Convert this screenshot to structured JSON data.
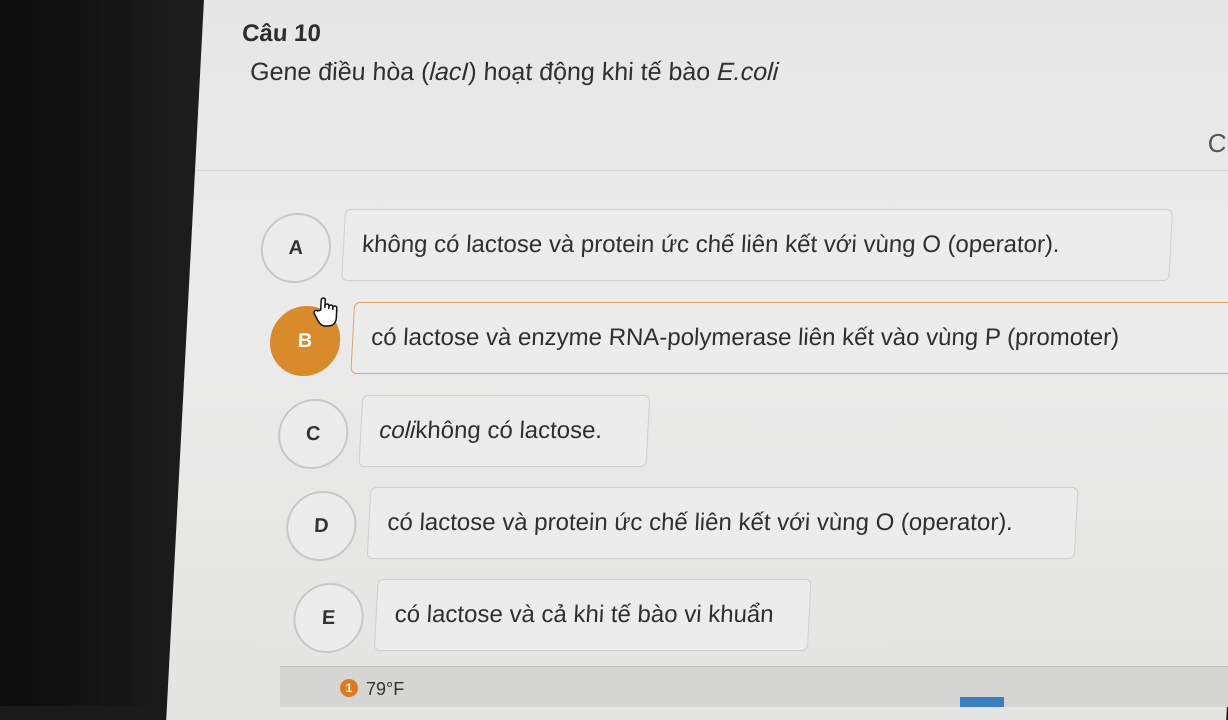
{
  "question": {
    "number": "Câu 10",
    "text_before": "Gene điều hòa (",
    "text_gene": "lacI",
    "text_middle": ") hoạt động khi tế bào ",
    "text_species": "E.coli"
  },
  "corner_icon": "C",
  "options": [
    {
      "letter": "A",
      "text": "không có lactose và protein ức chế liên kết với vùng O (operator)."
    },
    {
      "letter": "B",
      "text": "có lactose và enzyme RNA-polymerase liên kết vào vùng P (promoter)",
      "selected": true
    },
    {
      "letter": "C",
      "text_ital": "coli",
      "text": " không có lactose."
    },
    {
      "letter": "D",
      "text": "có lactose và protein ức chế liên kết với vùng O (operator)."
    },
    {
      "letter": "E",
      "text": "có lactose và cả khi tế bào vi khuẩn"
    }
  ],
  "taskbar": {
    "badge": "1",
    "weather": "79°F"
  },
  "colors": {
    "selected": "#d98a2b",
    "background": "#e9e9e9"
  }
}
